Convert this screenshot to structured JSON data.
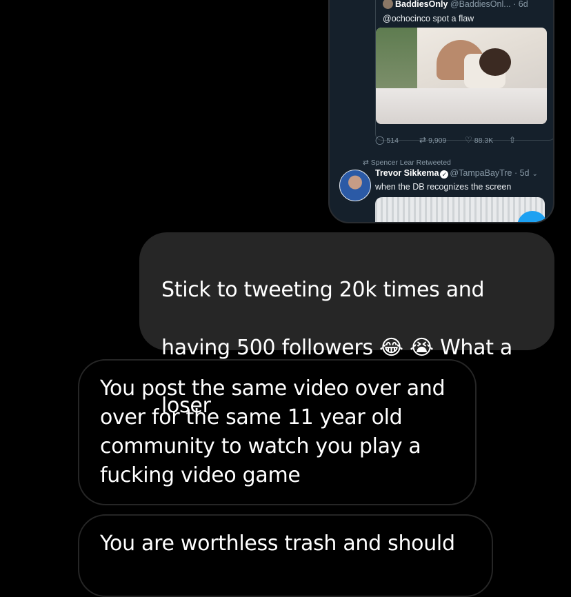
{
  "shared_tweet": {
    "quoted": {
      "name": "BaddiesOnly",
      "handle": "@BaddiesOnl...",
      "time": "· 6d",
      "text": "@ochocinco spot a flaw"
    },
    "actions": {
      "replies": "514",
      "retweets": "9,909",
      "likes": "88.3K"
    },
    "retweet_context": "Spencer Lear Retweeted",
    "tweet": {
      "name": "Trevor Sikkema",
      "handle": "@TampaBayTre",
      "time": "· 5d",
      "text": "when the DB recognizes the screen"
    }
  },
  "messages": [
    {
      "direction": "sent",
      "line1": "Stick to tweeting 20k times and",
      "line2_start": "having 500 followers",
      "emoji1": "😂",
      "emoji2": "😭",
      "line2_end": "What a",
      "line3": "loser"
    },
    {
      "direction": "received",
      "text": "You post the same video over and\nover for the same 11 year old\ncommunity to watch you play a\nfucking video game"
    },
    {
      "direction": "received",
      "text": "You are worthless trash and should"
    }
  ],
  "colors": {
    "background": "#000000",
    "sent_bubble": "#262626",
    "received_border": "#262626",
    "tweet_bg": "#15202b",
    "accent": "#1da1f2"
  }
}
